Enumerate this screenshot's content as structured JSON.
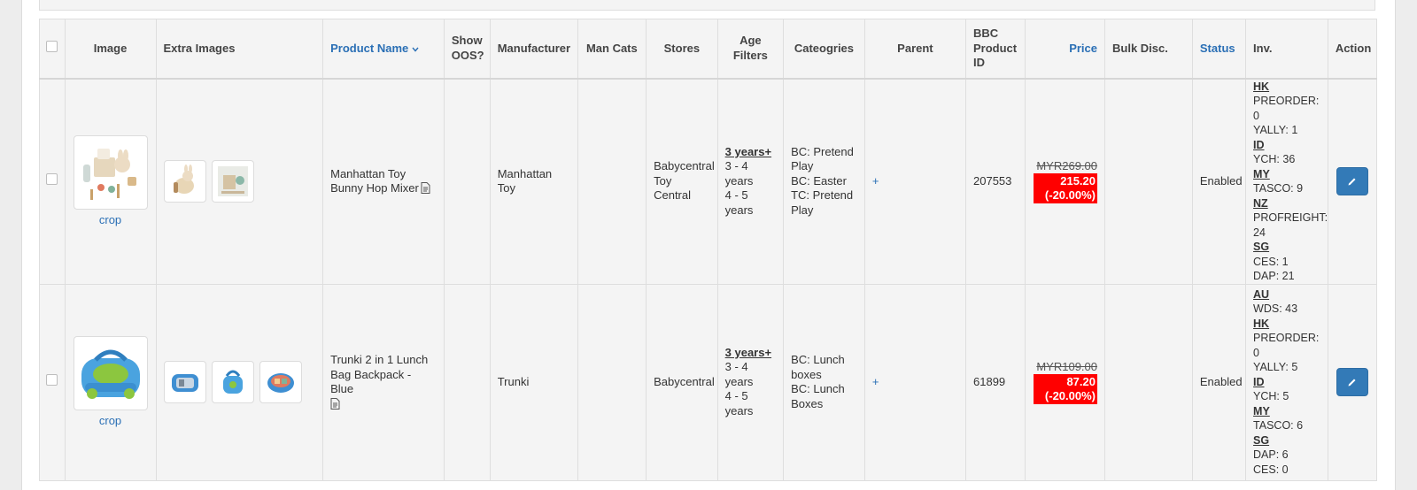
{
  "headers": {
    "image": "Image",
    "extra_images": "Extra Images",
    "product_name": "Product Name",
    "show_oos_1": "Show",
    "show_oos_2": "OOS?",
    "manufacturer": "Manufacturer",
    "man_cats": "Man Cats",
    "stores": "Stores",
    "age_filters_1": "Age",
    "age_filters_2": "Filters",
    "categories": "Cateogries",
    "parent": "Parent",
    "bbc_id_1": "BBC",
    "bbc_id_2": "Product",
    "bbc_id_3": "ID",
    "price": "Price",
    "bulk_disc": "Bulk Disc.",
    "status": "Status",
    "inv": "Inv.",
    "action": "Action"
  },
  "rows": [
    {
      "crop_label": "crop",
      "product_name": "Manhattan Toy Bunny Hop Mixer",
      "manufacturer": "Manhattan Toy",
      "stores": [
        "Babycentral",
        "Toy Central"
      ],
      "age_main": "3 years+",
      "ages": [
        "3 - 4 years",
        "4 - 5 years"
      ],
      "categories": [
        "BC: Pretend Play",
        "BC: Easter",
        "TC: Pretend Play"
      ],
      "parent": "+",
      "bbc_id": "207553",
      "price_old": "MYR269.00",
      "price_new": "215.20",
      "price_pct": "(-20.00%)",
      "status": "Enabled",
      "inv": [
        {
          "region": "HK",
          "items": [
            "PREORDER: 0",
            "YALLY: 1"
          ]
        },
        {
          "region": "ID",
          "items": [
            "YCH: 36"
          ]
        },
        {
          "region": "MY",
          "items": [
            "TASCO: 9"
          ]
        },
        {
          "region": "NZ",
          "items": [
            "PROFREIGHT:",
            "24"
          ]
        },
        {
          "region": "SG",
          "items": [
            "CES: 1",
            "DAP: 21"
          ]
        }
      ]
    },
    {
      "crop_label": "crop",
      "product_name": "Trunki 2 in 1 Lunch Bag Backpack - Blue",
      "manufacturer": "Trunki",
      "stores": [
        "Babycentral"
      ],
      "age_main": "3 years+",
      "ages": [
        "3 - 4 years",
        "4 - 5 years"
      ],
      "categories": [
        "BC: Lunch boxes",
        "BC: Lunch Boxes"
      ],
      "parent": "+",
      "bbc_id": "61899",
      "price_old": "MYR109.00",
      "price_new": "87.20",
      "price_pct": "(-20.00%)",
      "status": "Enabled",
      "inv": [
        {
          "region": "AU",
          "items": [
            "WDS: 43"
          ]
        },
        {
          "region": "HK",
          "items": [
            "PREORDER: 0",
            "YALLY: 5"
          ]
        },
        {
          "region": "ID",
          "items": [
            "YCH: 5"
          ]
        },
        {
          "region": "MY",
          "items": [
            "TASCO: 6"
          ]
        },
        {
          "region": "SG",
          "items": [
            "DAP: 6",
            "CES: 0"
          ]
        }
      ]
    }
  ],
  "icons": {
    "sort": "chevron-down-icon",
    "doc": "document-icon",
    "edit": "pencil-icon"
  },
  "colors": {
    "link": "#2a6fb5",
    "discount_bg": "#ff0000",
    "edit_button": "#337ab7"
  }
}
